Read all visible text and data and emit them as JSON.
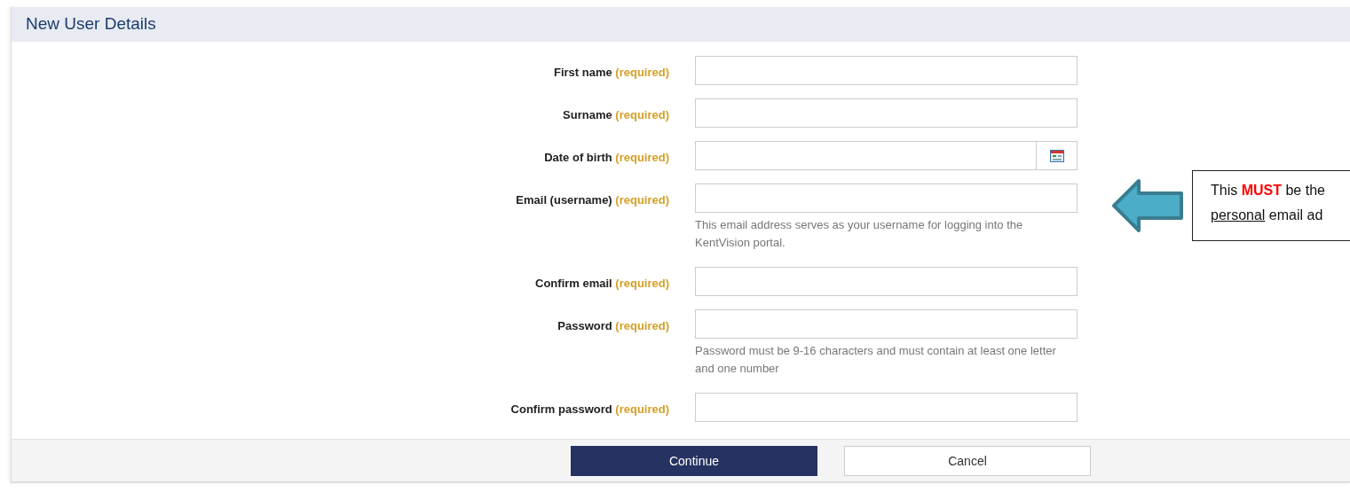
{
  "panel": {
    "title": "New User Details"
  },
  "fields": [
    {
      "label": "First name",
      "required": "(required)",
      "kind": "text"
    },
    {
      "label": "Surname",
      "required": "(required)",
      "kind": "text"
    },
    {
      "label": "Date of birth",
      "required": "(required)",
      "kind": "date"
    },
    {
      "label": "Email (username)",
      "required": "(required)",
      "kind": "text",
      "help": "This email address serves as your username for logging into the KentVision portal."
    },
    {
      "label": "Confirm email",
      "required": "(required)",
      "kind": "text"
    },
    {
      "label": "Password",
      "required": "(required)",
      "kind": "password",
      "help": "Password must be 9-16 characters and must contain at least one letter and one number"
    },
    {
      "label": "Confirm password",
      "required": "(required)",
      "kind": "password"
    }
  ],
  "buttons": [
    {
      "label": "Continue",
      "primary": true
    },
    {
      "label": "Cancel",
      "primary": false
    }
  ],
  "callout": {
    "line_1": "This **MUST** be the",
    "line_2_underlined": "personal",
    "line_2_rest": " email ad"
  }
}
